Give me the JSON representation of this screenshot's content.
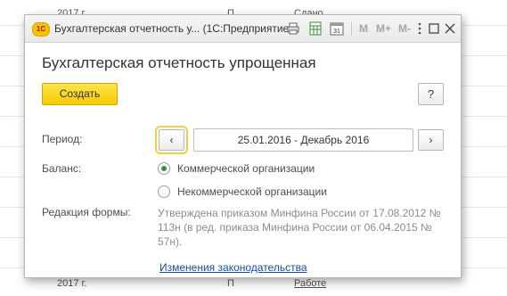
{
  "background_list": {
    "row1_col1": "2017 г.",
    "row1_col2": "П",
    "row1_col3": "Сдано",
    "row_last_col1": "2017 г.",
    "row_last_col2": "П",
    "row_last_col3": "Работе"
  },
  "window": {
    "logo_text": "1С",
    "title": "Бухгалтерская отчетность у... (1С:Предприятие)",
    "toolbar": {
      "m_label": "M",
      "mplus_label": "M+",
      "mminus_label": "M-",
      "calendar_label": "31"
    }
  },
  "form": {
    "title": "Бухгалтерская отчетность упрощенная",
    "create_button": "Создать",
    "help_button": "?",
    "period_label": "Период:",
    "period_value": "25.01.2016 - Декабрь 2016",
    "prev_button": "‹",
    "next_button": "›",
    "balance_label": "Баланс:",
    "balance_options": [
      {
        "label": "Коммерческой организации",
        "selected": true
      },
      {
        "label": "Некоммерческой организации",
        "selected": false
      }
    ],
    "edition_label": "Редакция формы:",
    "edition_text": "Утверждена приказом Минфина России от 17.08.2012 № 113н (в ред. приказа Минфина России от 06.04.2015 № 57н).",
    "changes_link": "Изменения законодательства"
  },
  "colors": {
    "accent_yellow": "#f5cc00",
    "radio_selected": "#3b8d3e",
    "link": "#1a4a9c"
  }
}
